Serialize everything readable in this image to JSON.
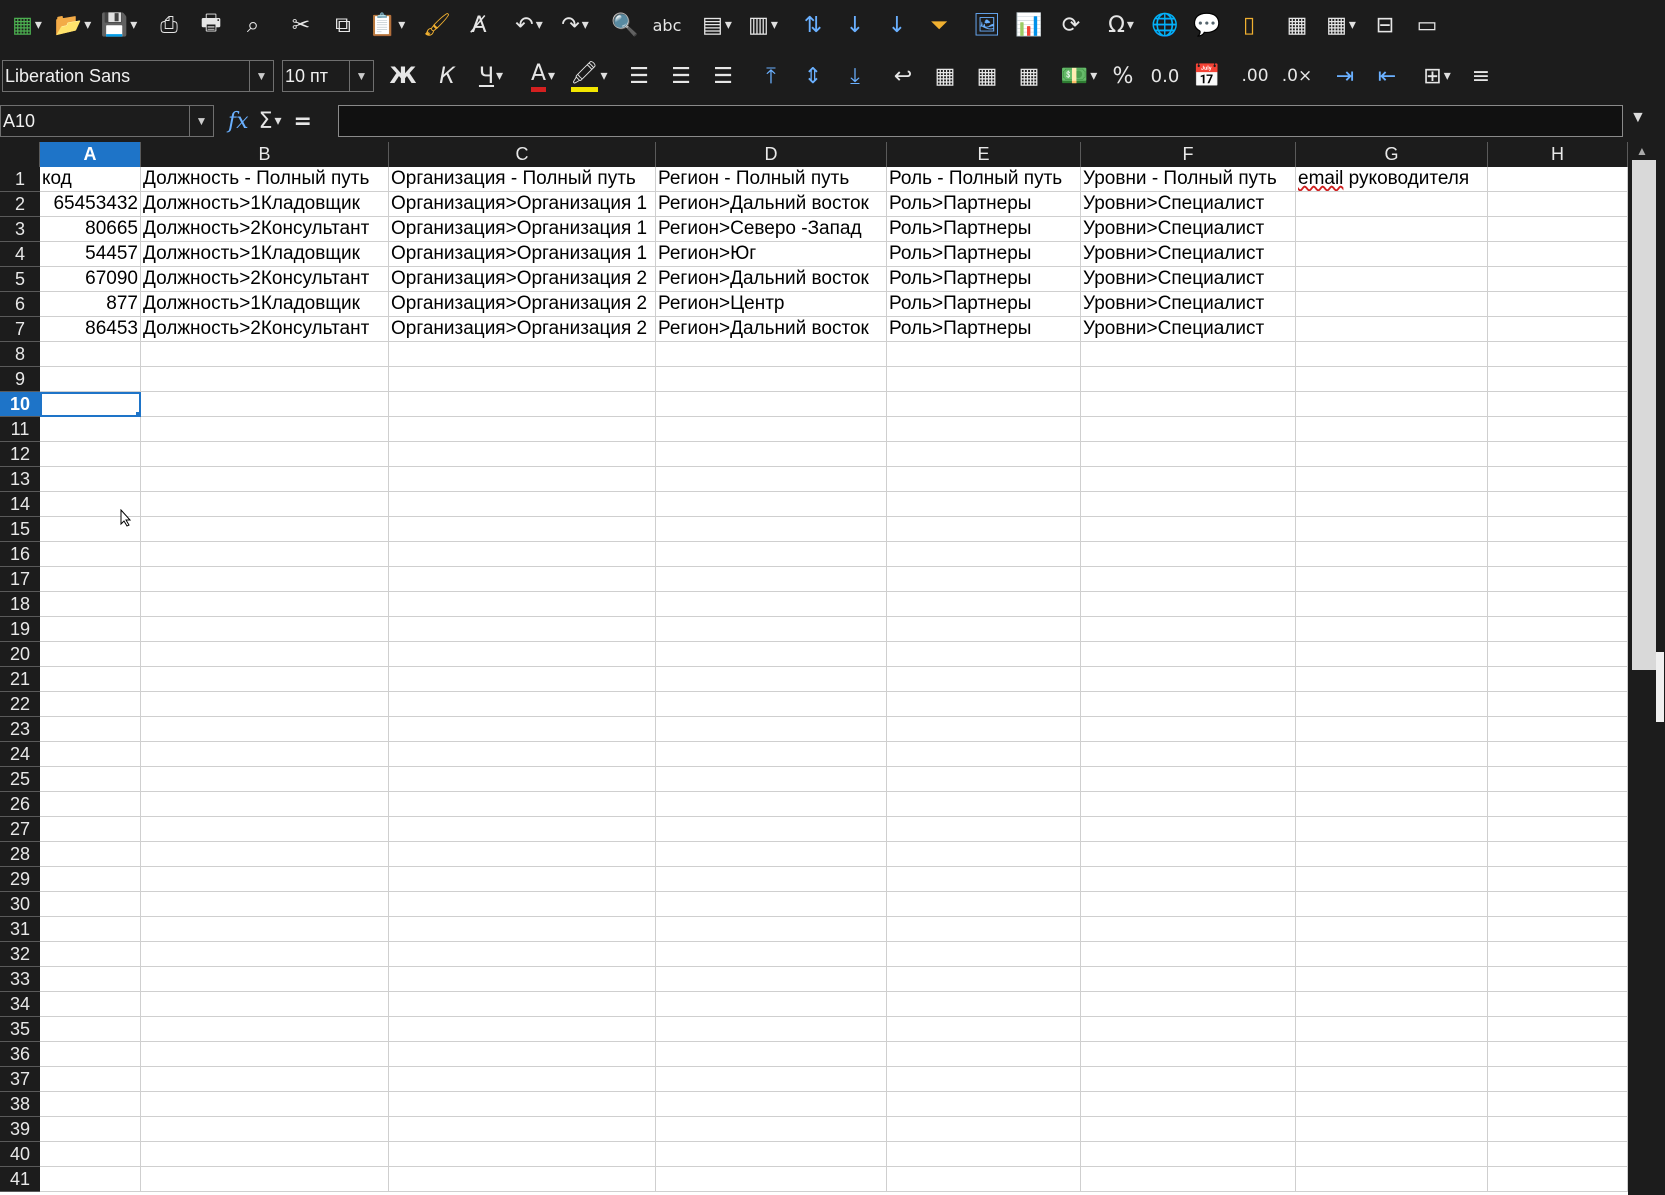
{
  "toolbar1": {
    "icons": [
      "new-spreadsheet-icon",
      "open-icon",
      "save-icon",
      "export-pdf-icon",
      "print-icon",
      "print-preview-icon",
      "cut-icon",
      "copy-icon",
      "paste-icon",
      "clone-formatting-icon",
      "clear-formatting-icon",
      "undo-icon",
      "redo-icon",
      "find-replace-icon",
      "spelling-icon",
      "row-icon",
      "column-icon",
      "sort-icon",
      "sort-ascending-icon",
      "sort-descending-icon",
      "autofilter-icon",
      "insert-image-icon",
      "insert-chart-icon",
      "pivot-table-icon",
      "special-character-icon",
      "hyperlink-icon",
      "comment-icon",
      "header-footer-icon",
      "define-print-area-icon",
      "freeze-rows-icon",
      "split-window-icon",
      "show-draw-icon"
    ]
  },
  "toolbar2": {
    "font_name": "Liberation Sans",
    "font_size": "10 пт",
    "bold_label": "Ж",
    "italic_label": "К",
    "underline_label": "Ч",
    "font_color": "#d42020",
    "highlight_color": "#f2e600"
  },
  "formula_bar": {
    "name_box": "A10",
    "fx_label": "fx",
    "sum_label": "Σ",
    "equals_label": "=",
    "formula_value": ""
  },
  "sheet": {
    "columns": [
      "A",
      "B",
      "C",
      "D",
      "E",
      "F",
      "G",
      "H"
    ],
    "selected_column": "A",
    "selected_row": 10,
    "active_cell": "A10",
    "row_count": 41,
    "rows": [
      [
        "код",
        "Должность - Полный путь",
        "Организация - Полный путь",
        "Регион - Полный путь",
        "Роль - Полный путь",
        "Уровни - Полный путь",
        "email руководителя",
        ""
      ],
      [
        "65453432",
        "Должность>1Кладовщик",
        "Организация>Организация 1",
        "Регион>Дальний восток",
        "Роль>Партнеры",
        "Уровни>Специалист",
        "",
        ""
      ],
      [
        "80665",
        "Должность>2Консультант",
        "Организация>Организация 1",
        "Регион>Северо -Запад",
        "Роль>Партнеры",
        "Уровни>Специалист",
        "",
        ""
      ],
      [
        "54457",
        "Должность>1Кладовщик",
        "Организация>Организация 1",
        "Регион>Юг",
        "Роль>Партнеры",
        "Уровни>Специалист",
        "",
        ""
      ],
      [
        "67090",
        "Должность>2Консультант",
        "Организация>Организация 2",
        "Регион>Дальний восток",
        "Роль>Партнеры",
        "Уровни>Специалист",
        "",
        ""
      ],
      [
        "877",
        "Должность>1Кладовщик",
        "Организация>Организация 2",
        "Регион>Центр",
        "Роль>Партнеры",
        "Уровни>Специалист",
        "",
        ""
      ],
      [
        "86453",
        "Должность>2Консультант",
        "Организация>Организация 2",
        "Регион>Дальний восток",
        "Роль>Партнеры",
        "Уровни>Специалист",
        "",
        ""
      ]
    ]
  },
  "colors": {
    "selection": "#1e74c8",
    "chrome_bg": "#1c1c1c",
    "grid_line": "#cfcfcf"
  }
}
